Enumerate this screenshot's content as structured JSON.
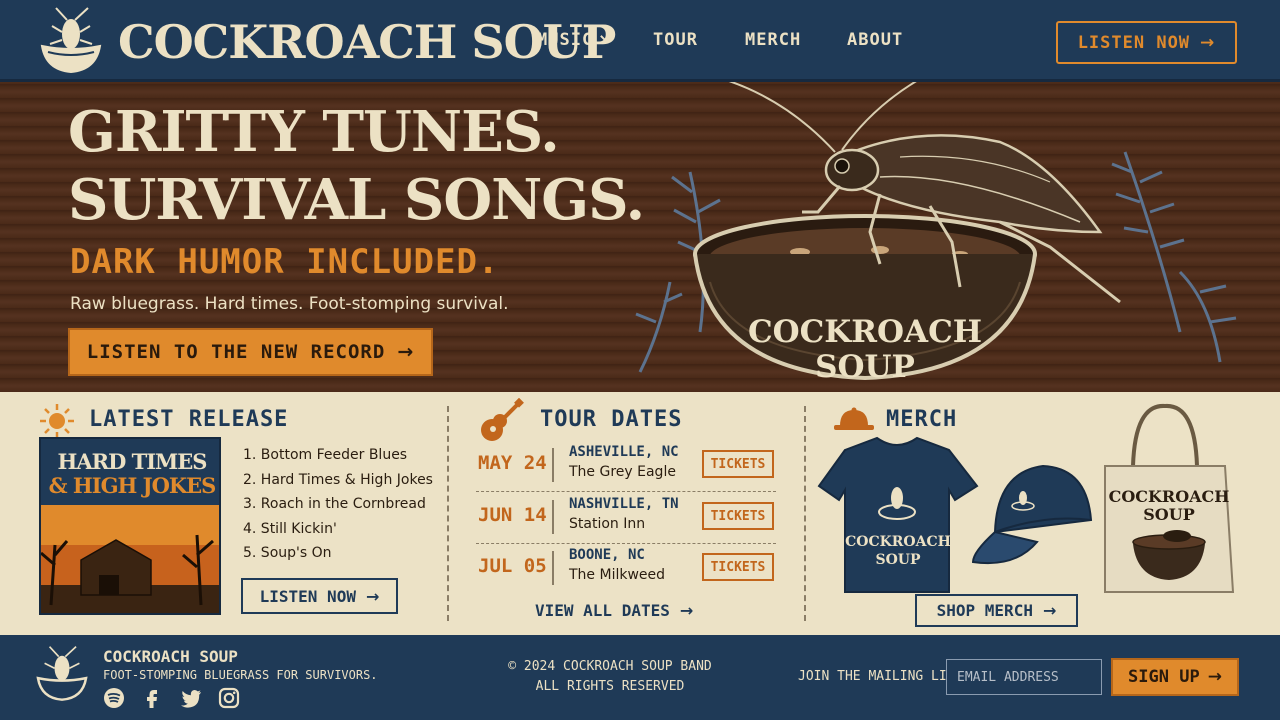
{
  "header": {
    "brand": "COCKROACH SOUP",
    "nav": {
      "music": "MUSIC",
      "tour": "TOUR",
      "merch": "MERCH",
      "about": "ABOUT"
    },
    "cta": "LISTEN NOW"
  },
  "hero": {
    "line1": "GRITTY TUNES.",
    "line2": "SURVIVAL SONGS.",
    "line3": "DARK HUMOR INCLUDED.",
    "subtitle": "Raw bluegrass. Hard times. Foot-stomping survival.",
    "cta": "LISTEN TO THE NEW RECORD",
    "bowl_text_1": "COCKROACH",
    "bowl_text_2": "SOUP"
  },
  "latest_release": {
    "title": "LATEST RELEASE",
    "album_title_1": "HARD TIMES",
    "album_title_2": "& HIGH JOKES",
    "tracks": [
      "1. Bottom Feeder Blues",
      "2. Hard Times & High Jokes",
      "3. Roach in the Cornbread",
      "4. Still Kickin'",
      "5. Soup's On"
    ],
    "cta": "LISTEN NOW"
  },
  "tour": {
    "title": "TOUR DATES",
    "dates": [
      {
        "date": "MAY 24",
        "city": "ASHEVILLE, NC",
        "venue": "The Grey Eagle",
        "button": "TICKETS"
      },
      {
        "date": "JUN 14",
        "city": "NASHVILLE, TN",
        "venue": "Station Inn",
        "button": "TICKETS"
      },
      {
        "date": "JUL 05",
        "city": "BOONE, NC",
        "venue": "The Milkweed",
        "button": "TICKETS"
      }
    ],
    "view_all": "VIEW ALL DATES"
  },
  "merch": {
    "title": "MERCH",
    "shirt_text_1": "COCKROACH",
    "shirt_text_2": "SOUP",
    "tote_text_1": "COCKROACH",
    "tote_text_2": "SOUP",
    "cta": "SHOP MERCH"
  },
  "footer": {
    "name": "COCKROACH SOUP",
    "tagline": "FOOT-STOMPING BLUEGRASS FOR SURVIVORS.",
    "copyright_1": "© 2024 COCKROACH SOUP BAND",
    "copyright_2": "ALL RIGHTS RESERVED",
    "mailing_label": "JOIN THE MAILING LIST",
    "email_placeholder": "EMAIL ADDRESS",
    "signup": "SIGN UP"
  },
  "icons": {
    "logo": "cockroach-bowl-icon",
    "arrow": "arrow-right-icon",
    "sun": "sun-icon",
    "guitar": "guitar-icon",
    "hat": "hat-icon",
    "social": [
      "spotify-icon",
      "facebook-icon",
      "twitter-icon",
      "instagram-icon"
    ]
  },
  "colors": {
    "navy": "#1f3a57",
    "cream": "#ece1c4",
    "orange": "#e08a2c",
    "wood": "#4a2a18"
  }
}
